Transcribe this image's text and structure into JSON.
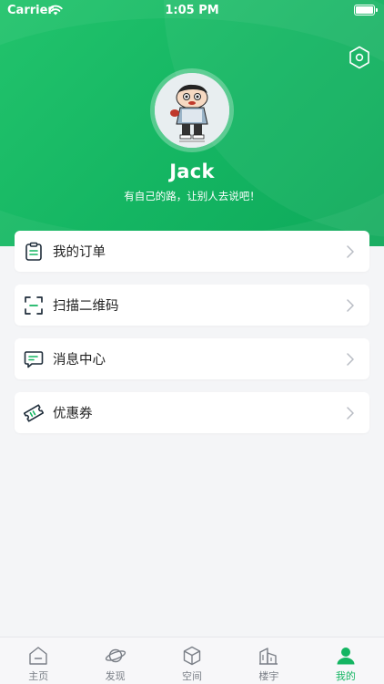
{
  "status_bar": {
    "carrier": "Carrier",
    "time": "1:05 PM"
  },
  "profile": {
    "name": "Jack",
    "motto": "有自己的路，让别人去说吧！"
  },
  "menu": [
    {
      "label": "我的订单",
      "icon": "order-list-icon"
    },
    {
      "label": "扫描二维码",
      "icon": "scan-icon"
    },
    {
      "label": "消息中心",
      "icon": "message-icon"
    },
    {
      "label": "优惠券",
      "icon": "coupon-icon"
    }
  ],
  "tabbar": [
    {
      "label": "主页",
      "icon": "home-icon",
      "active": false
    },
    {
      "label": "发现",
      "icon": "planet-icon",
      "active": false
    },
    {
      "label": "空间",
      "icon": "cube-icon",
      "active": false
    },
    {
      "label": "楼宇",
      "icon": "building-icon",
      "active": false
    },
    {
      "label": "我的",
      "icon": "person-icon",
      "active": true
    }
  ],
  "colors": {
    "brand": "#14b562",
    "background": "#f4f5f7",
    "tab_inactive": "#7a7f87"
  }
}
